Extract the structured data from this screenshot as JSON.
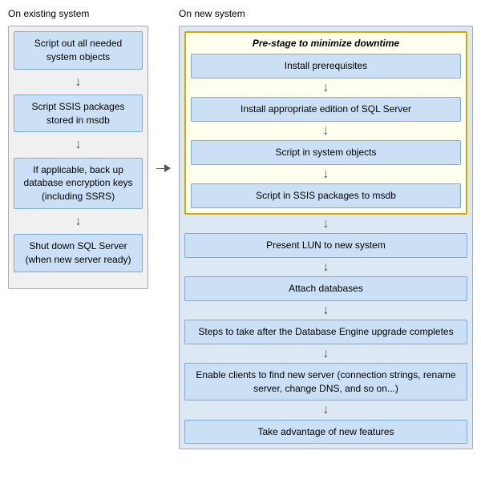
{
  "left_title": "On existing system",
  "right_title": "On new system",
  "left_steps": [
    "Script out all needed system objects",
    "Script SSIS packages stored in msdb",
    "If applicable, back up database encryption keys (including SSRS)",
    "Shut down SQL Server (when new server ready)"
  ],
  "prestage_title": "Pre-stage to minimize downtime",
  "prestage_steps": [
    "Install prerequisites",
    "Install appropriate edition of SQL Server",
    "Script in system objects",
    "Script in SSIS packages to msdb"
  ],
  "right_steps": [
    "Present LUN to new system",
    "Attach databases",
    "Steps to take after the Database Engine upgrade completes",
    "Enable clients to find new server (connection strings, rename server, change DNS, and so on...)",
    "Take advantage of new features"
  ],
  "arrow_down": "↓",
  "arrow_right": "→"
}
